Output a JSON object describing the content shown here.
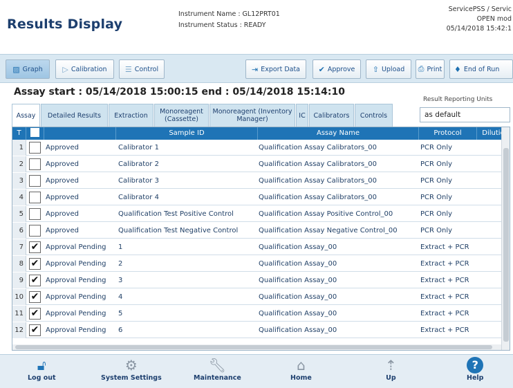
{
  "header": {
    "title": "Results Display",
    "instrument_name": "Instrument Name : GL12PRT01",
    "instrument_status": "Instrument Status : READY",
    "user": "ServicePSS / Servic",
    "mode": "OPEN mod",
    "datetime": "05/14/2018 15:42:1"
  },
  "toolbar": {
    "graph": "Graph",
    "calibration": "Calibration",
    "control": "Control",
    "export_data": "Export Data",
    "approve": "Approve",
    "upload": "Upload",
    "print": "Print",
    "end_of_run": "End of Run"
  },
  "assay_line": "Assay  start : 05/14/2018 15:00:15  end : 05/14/2018 15:14:10",
  "reporting_units": {
    "label": "Result Reporting Units",
    "value": "as default"
  },
  "tabs": [
    {
      "label": "Assay"
    },
    {
      "label": "Detailed Results"
    },
    {
      "label": "Extraction"
    },
    {
      "label": "Monoreagent (Cassette)"
    },
    {
      "label": "Monoreagent (Inventory Manager)"
    },
    {
      "label": "IC"
    },
    {
      "label": "Calibrators"
    },
    {
      "label": "Controls"
    }
  ],
  "columns": {
    "t": "T",
    "sample_id": "Sample ID",
    "assay_name": "Assay Name",
    "protocol": "Protocol",
    "dilution": "Dilutio"
  },
  "rows": [
    {
      "num": "1",
      "checked": "",
      "status": "Approved",
      "sample_id": "Calibrator 1",
      "assay_name": "Qualification Assay Calibrators_00",
      "protocol": "PCR Only"
    },
    {
      "num": "2",
      "checked": "",
      "status": "Approved",
      "sample_id": "Calibrator 2",
      "assay_name": "Qualification Assay Calibrators_00",
      "protocol": "PCR Only"
    },
    {
      "num": "3",
      "checked": "",
      "status": "Approved",
      "sample_id": "Calibrator 3",
      "assay_name": "Qualification Assay Calibrators_00",
      "protocol": "PCR Only"
    },
    {
      "num": "4",
      "checked": "",
      "status": "Approved",
      "sample_id": "Calibrator 4",
      "assay_name": "Qualification Assay Calibrators_00",
      "protocol": "PCR Only"
    },
    {
      "num": "5",
      "checked": "",
      "status": "Approved",
      "sample_id": "Qualification Test Positive Control",
      "assay_name": "Qualification Assay Positive Control_00",
      "protocol": "PCR Only"
    },
    {
      "num": "6",
      "checked": "",
      "status": "Approved",
      "sample_id": "Qualification Test Negative Control",
      "assay_name": "Qualification Assay Negative Control_00",
      "protocol": "PCR Only"
    },
    {
      "num": "7",
      "checked": "✔",
      "status": "Approval Pending",
      "sample_id": "1",
      "assay_name": "Qualification Assay_00",
      "protocol": "Extract + PCR"
    },
    {
      "num": "8",
      "checked": "✔",
      "status": "Approval Pending",
      "sample_id": "2",
      "assay_name": "Qualification Assay_00",
      "protocol": "Extract + PCR"
    },
    {
      "num": "9",
      "checked": "✔",
      "status": "Approval Pending",
      "sample_id": "3",
      "assay_name": "Qualification Assay_00",
      "protocol": "Extract + PCR"
    },
    {
      "num": "10",
      "checked": "✔",
      "status": "Approval Pending",
      "sample_id": "4",
      "assay_name": "Qualification Assay_00",
      "protocol": "Extract + PCR"
    },
    {
      "num": "11",
      "checked": "✔",
      "status": "Approval Pending",
      "sample_id": "5",
      "assay_name": "Qualification Assay_00",
      "protocol": "Extract + PCR"
    },
    {
      "num": "12",
      "checked": "✔",
      "status": "Approval Pending",
      "sample_id": "6",
      "assay_name": "Qualification Assay_00",
      "protocol": "Extract + PCR"
    }
  ],
  "bottom_nav": {
    "logout": "Log out",
    "system_settings": "System Settings",
    "maintenance": "Maintenance",
    "home": "Home",
    "up": "Up",
    "help": "Help"
  },
  "icons": {
    "graph": "graph-icon",
    "calibration": "calibration-icon",
    "control": "control-icon",
    "export": "export-icon",
    "approve": "check-icon",
    "upload": "upload-icon",
    "print": "print-icon",
    "end_of_run": "end-of-run-icon",
    "logout": "lock-icon",
    "settings": "gear-icon",
    "maintenance": "wrench-icon",
    "home": "home-icon",
    "up": "up-icon",
    "help": "help-icon"
  },
  "colors": {
    "title": "#1d3f6e",
    "grid_header": "#1f74b6",
    "toolbar_bg": "#d9e8f2",
    "approve_green": "#2e8b2e",
    "help_blue": "#1f74b6"
  }
}
